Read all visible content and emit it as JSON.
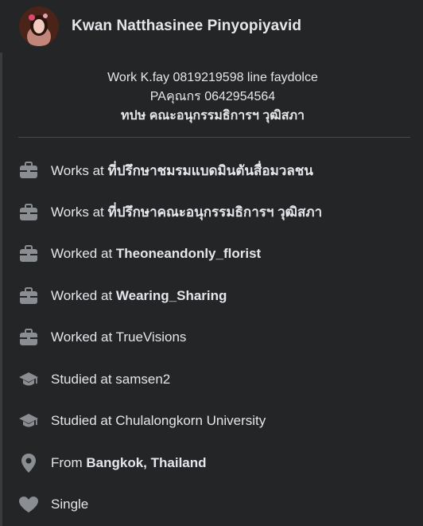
{
  "profile": {
    "name": "Kwan Natthasinee Pinyopiyavid"
  },
  "bio": {
    "line1": "Work K.fay 0819219598 line faydolce",
    "line2": "PAคุณกร 0642954564",
    "line3": "ทปษ คณะอนุกรรมธิการฯ วุฒิสภา"
  },
  "details": [
    {
      "icon": "briefcase-icon",
      "prefix": "Works at ",
      "value": "ที่ปรึกษาชมรมแบดมินตันสื่อมวลชน"
    },
    {
      "icon": "briefcase-icon",
      "prefix": "Works at ",
      "value": "ที่ปรึกษาคณะอนุกรรมธิการฯ วุฒิสภา"
    },
    {
      "icon": "briefcase-icon",
      "prefix": "Worked at ",
      "value": "Theoneandonly_florist"
    },
    {
      "icon": "briefcase-icon",
      "prefix": "Worked at ",
      "value": "Wearing_Sharing"
    },
    {
      "icon": "briefcase-icon",
      "prefix": "Worked at TrueVisions",
      "value": ""
    },
    {
      "icon": "graduation-cap-icon",
      "prefix": "Studied at samsen2",
      "value": ""
    },
    {
      "icon": "graduation-cap-icon",
      "prefix": "Studied at Chulalongkorn University",
      "value": ""
    },
    {
      "icon": "location-pin-icon",
      "prefix": "From ",
      "value": "Bangkok, Thailand"
    },
    {
      "icon": "heart-icon",
      "prefix": "Single",
      "value": ""
    }
  ],
  "colors": {
    "background": "#18191a",
    "card": "#242526",
    "text": "#e4e6eb",
    "icon": "#8a8d91"
  }
}
